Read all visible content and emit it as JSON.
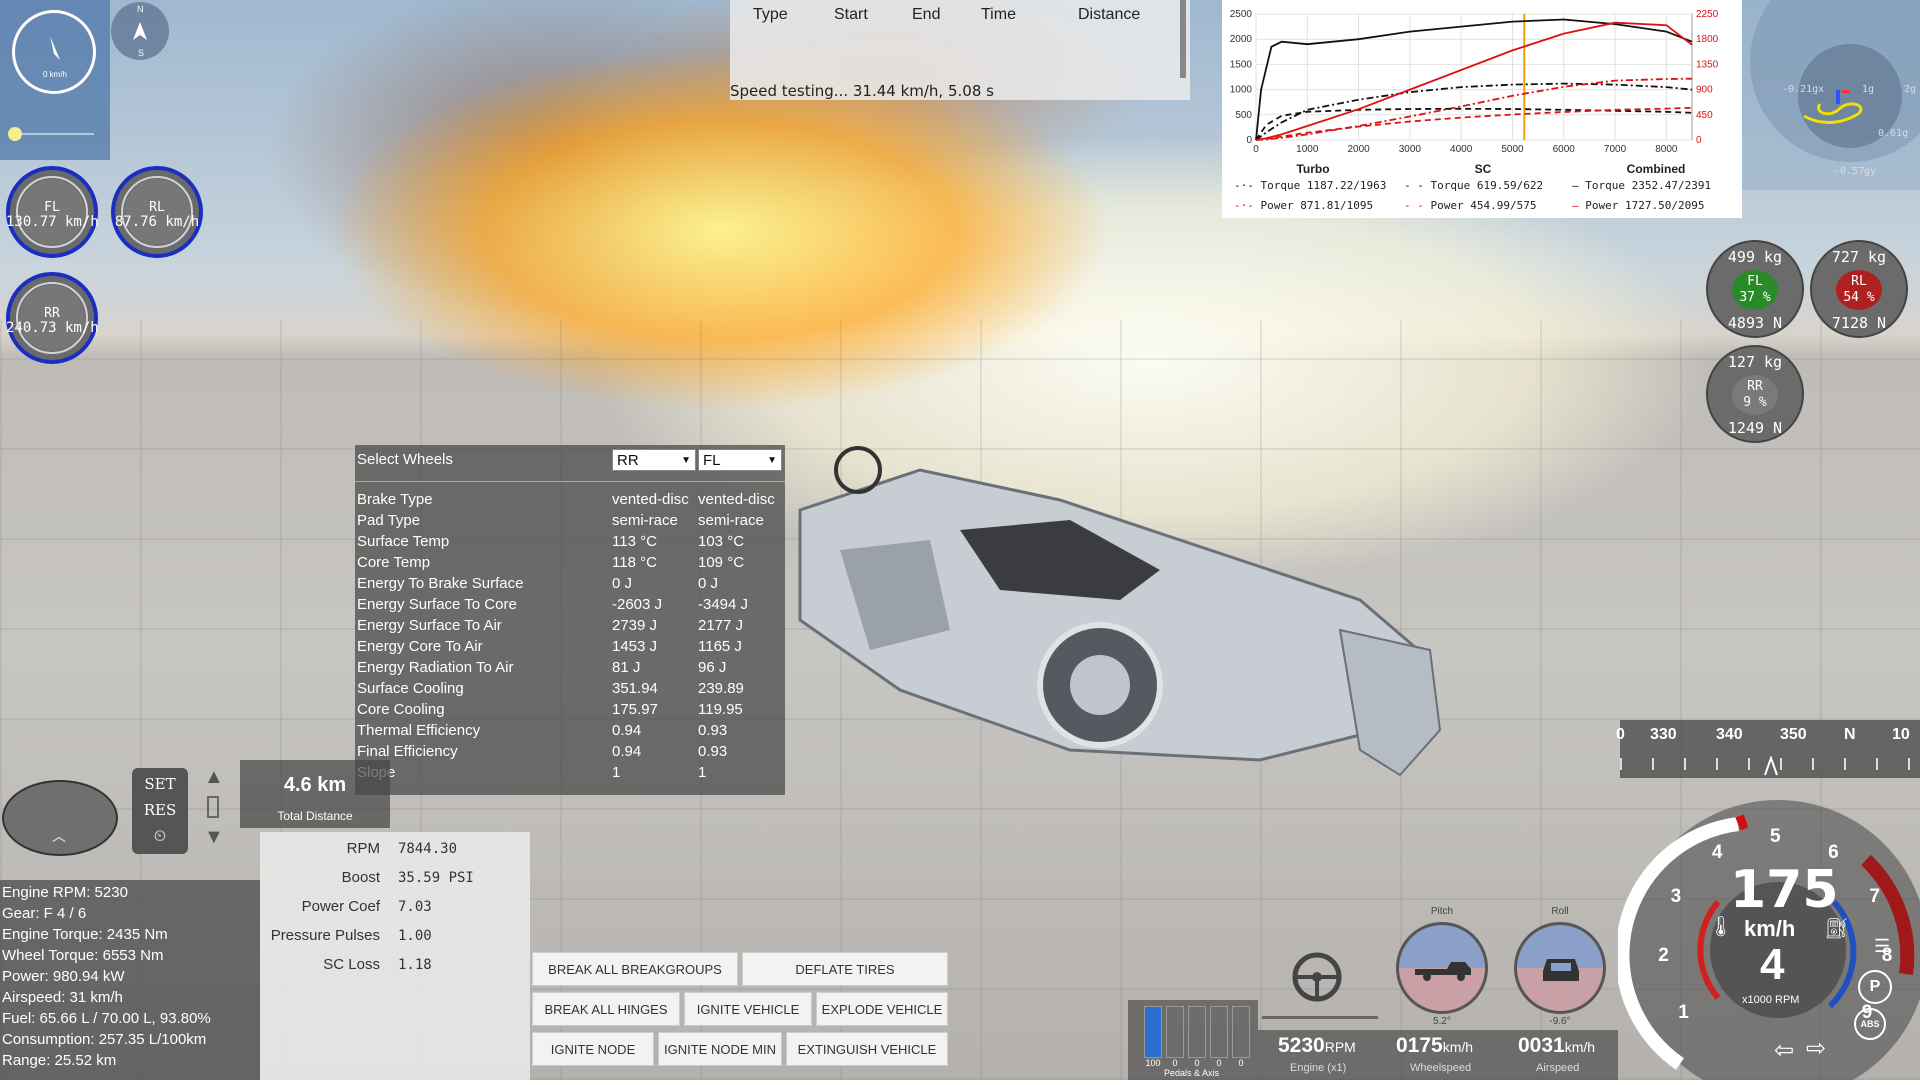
{
  "minimap": {
    "speed_text": "0 km/h"
  },
  "compass_mini": {
    "n": "N",
    "s": "S"
  },
  "wheel_speeds": [
    {
      "label": "FL",
      "value": "130.77 km/h"
    },
    {
      "label": "RL",
      "value": "87.76 km/h"
    },
    {
      "label": "RR",
      "value": "240.73 km/h"
    }
  ],
  "speed_test": {
    "headers": [
      "Type",
      "Start",
      "End",
      "Time",
      "Distance"
    ],
    "status": "Speed testing... 31.44 km/h, 5.08 s"
  },
  "chart_data": {
    "type": "line",
    "x_ticks": [
      "0",
      "1000",
      "2000",
      "3000",
      "4000",
      "5000",
      "6000",
      "7000",
      "8000"
    ],
    "y_left_ticks": [
      "0",
      "500",
      "1000",
      "1500",
      "2000",
      "2500"
    ],
    "y_right_ticks": [
      "0",
      "450",
      "900",
      "1350",
      "1800",
      "2250"
    ],
    "xlim": [
      0,
      8500
    ],
    "ylim_left": [
      0,
      2500
    ],
    "ylim_right": [
      0,
      2250
    ],
    "marker_x": 5230,
    "colors": {
      "torque": "#111111",
      "power": "#dd1111",
      "marker": "#f0a000"
    },
    "series": [
      {
        "name": "Turbo Torque",
        "axis": "left",
        "style": "dashdot",
        "x": [
          0,
          200,
          500,
          1000,
          2000,
          3000,
          4000,
          5000,
          6000,
          7000,
          8000,
          8500
        ],
        "y": [
          0,
          150,
          350,
          600,
          800,
          950,
          1050,
          1100,
          1120,
          1100,
          1050,
          1000
        ]
      },
      {
        "name": "Turbo Power",
        "axis": "right",
        "style": "dashdot",
        "x": [
          0,
          200,
          500,
          1000,
          2000,
          3000,
          4000,
          5000,
          6000,
          7000,
          8000,
          8500
        ],
        "y": [
          0,
          10,
          40,
          100,
          250,
          420,
          600,
          790,
          950,
          1060,
          1090,
          1095
        ]
      },
      {
        "name": "SC Torque",
        "axis": "left",
        "style": "dash",
        "x": [
          0,
          200,
          500,
          1000,
          2000,
          3000,
          4000,
          5000,
          6000,
          7000,
          8000,
          8500
        ],
        "y": [
          0,
          300,
          480,
          560,
          600,
          615,
          619,
          615,
          600,
          580,
          560,
          540
        ]
      },
      {
        "name": "SC Power",
        "axis": "right",
        "style": "dash",
        "x": [
          0,
          200,
          500,
          1000,
          2000,
          3000,
          4000,
          5000,
          6000,
          7000,
          8000,
          8500
        ],
        "y": [
          0,
          20,
          60,
          130,
          240,
          330,
          400,
          455,
          500,
          540,
          560,
          575
        ]
      },
      {
        "name": "Combined Torque",
        "axis": "left",
        "style": "solid",
        "x": [
          0,
          100,
          300,
          500,
          1000,
          2000,
          3000,
          4000,
          5000,
          6000,
          7000,
          8000,
          8500
        ],
        "y": [
          0,
          1000,
          1850,
          1950,
          1900,
          2000,
          2150,
          2250,
          2350,
          2391,
          2300,
          2150,
          1950
        ]
      },
      {
        "name": "Combined Power",
        "axis": "right",
        "style": "solid",
        "x": [
          0,
          200,
          500,
          1000,
          2000,
          3000,
          4000,
          5000,
          6000,
          7000,
          8000,
          8500
        ],
        "y": [
          0,
          30,
          100,
          250,
          550,
          900,
          1250,
          1600,
          1900,
          2095,
          2050,
          1700
        ]
      }
    ],
    "legend": [
      {
        "group": "Turbo",
        "torque": "Torque 1187.22/1963",
        "power": "Power  871.81/1095"
      },
      {
        "group": "SC",
        "torque": "Torque 619.59/622",
        "power": "Power  454.99/575"
      },
      {
        "group": "Combined",
        "torque": "Torque 2352.47/2391",
        "power": "Power  1727.50/2095"
      }
    ]
  },
  "gmeter": {
    "left": "-0.21gx",
    "right": "2g",
    "inner": "1g",
    "ry": "0.61g",
    "bottom": "-0.57gy"
  },
  "tire_loads": [
    {
      "id": "FL",
      "mass": "499 kg",
      "pct": "37 %",
      "force": "4893 N",
      "color": "#2a8a2a"
    },
    {
      "id": "RL",
      "mass": "727 kg",
      "pct": "54 %",
      "force": "7128 N",
      "color": "#b02020"
    },
    {
      "id": "RR",
      "mass": "127 kg",
      "pct": "9 %",
      "force": "1249 N",
      "color": "#7a7a7a"
    }
  ],
  "brakes": {
    "title": "Select Wheels",
    "select1": "RR",
    "select2": "FL",
    "rows": [
      {
        "label": "Brake Type",
        "a": "vented-disc",
        "b": "vented-disc"
      },
      {
        "label": "Pad Type",
        "a": "semi-race",
        "b": "semi-race"
      },
      {
        "label": "Surface Temp",
        "a": "113 °C",
        "b": "103 °C"
      },
      {
        "label": "Core Temp",
        "a": "118 °C",
        "b": "109 °C"
      },
      {
        "label": "Energy To Brake Surface",
        "a": "0 J",
        "b": "0 J"
      },
      {
        "label": "Energy Surface To Core",
        "a": "-2603 J",
        "b": "-3494 J"
      },
      {
        "label": "Energy Surface To Air",
        "a": "2739 J",
        "b": "2177 J"
      },
      {
        "label": "Energy Core To Air",
        "a": "1453 J",
        "b": "1165 J"
      },
      {
        "label": "Energy Radiation To Air",
        "a": "81 J",
        "b": "96 J"
      },
      {
        "label": "Surface Cooling",
        "a": "351.94",
        "b": "239.89"
      },
      {
        "label": "Core Cooling",
        "a": "175.97",
        "b": "119.95"
      },
      {
        "label": "Thermal Efficiency",
        "a": "0.94",
        "b": "0.93"
      },
      {
        "label": "Final Efficiency",
        "a": "0.94",
        "b": "0.93"
      },
      {
        "label": "Slope",
        "a": "1",
        "b": "1"
      }
    ]
  },
  "cruise": {
    "set": "SET",
    "res": "RES"
  },
  "distance": {
    "value": "4.6 km",
    "label": "Total Distance"
  },
  "stats": [
    "Engine RPM: 5230",
    "Gear: F 4 / 6",
    "Engine Torque: 2435 Nm",
    "Wheel Torque: 6553 Nm",
    "Power: 980.94 kW",
    "Airspeed: 31 km/h",
    "Fuel: 65.66 L / 70.00 L, 93.80%",
    "Consumption: 257.35 L/100km",
    "Range: 25.52 km"
  ],
  "engine": [
    {
      "label": "RPM",
      "value": "7844.30"
    },
    {
      "label": "Boost",
      "value": "35.59 PSI"
    },
    {
      "label": "Power Coef",
      "value": "7.03"
    },
    {
      "label": "Pressure Pulses",
      "value": "1.00"
    },
    {
      "label": "SC Loss",
      "value": "1.18"
    }
  ],
  "actions": {
    "break_breakgroups": "BREAK ALL BREAKGROUPS",
    "deflate_tires": "DEFLATE TIRES",
    "break_hinges": "BREAK ALL HINGES",
    "ignite_vehicle": "IGNITE VEHICLE",
    "explode_vehicle": "EXPLODE VEHICLE",
    "ignite_node": "IGNITE NODE",
    "ignite_node_min": "IGNITE NODE MIN",
    "extinguish_vehicle": "EXTINGUISH VEHICLE"
  },
  "pedals": {
    "values": [
      "100",
      "0",
      "0",
      "0",
      "0"
    ],
    "caption": "Pedals & Axis"
  },
  "rpm_strip": {
    "rpm_value": "5230",
    "rpm_unit": "RPM",
    "rpm_cap": "Engine (x1)",
    "wheel_value": "0175",
    "wheel_unit": "km/h",
    "wheel_cap": "Wheelspeed",
    "air_value": "0031",
    "air_unit": "km/h",
    "air_cap": "Airspeed"
  },
  "attitude": {
    "pitch_label": "Pitch",
    "pitch_value": "5.2°",
    "roll_label": "Roll",
    "roll_value": "-9.6°"
  },
  "heading": {
    "ticks": [
      "0",
      "330",
      "340",
      "350",
      "N",
      "10"
    ]
  },
  "speedo": {
    "speed": "175",
    "unit": "km/h",
    "gear": "4",
    "rpm_unit": "x1000 RPM",
    "rpm_ticks": [
      "1",
      "2",
      "3",
      "4",
      "5",
      "6",
      "7",
      "8",
      "9"
    ],
    "abs": "ABS",
    "park": "P"
  }
}
